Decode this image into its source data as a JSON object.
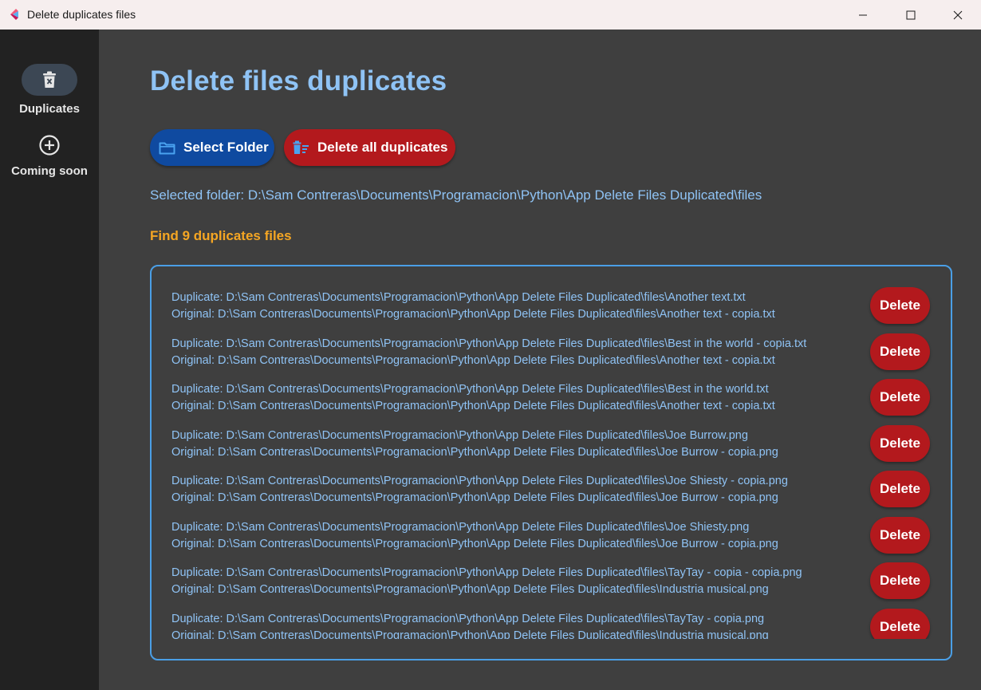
{
  "window": {
    "title": "Delete duplicates files"
  },
  "sidebar": {
    "items": [
      {
        "label": "Duplicates",
        "icon": "trash-icon",
        "selected": true
      },
      {
        "label": "Coming soon",
        "icon": "add-circle-icon",
        "selected": false
      }
    ]
  },
  "main": {
    "title": "Delete files duplicates",
    "select_folder_label": "Select Folder",
    "delete_all_label": "Delete all duplicates",
    "selected_folder": "Selected folder: D:\\Sam Contreras\\Documents\\Programacion\\Python\\App Delete Files Duplicated\\files",
    "duplicates_count": "Find 9 duplicates files",
    "delete_label": "Delete",
    "rows": [
      {
        "duplicate": "Duplicate: D:\\Sam Contreras\\Documents\\Programacion\\Python\\App Delete Files Duplicated\\files\\Another text.txt",
        "original": "Original: D:\\Sam Contreras\\Documents\\Programacion\\Python\\App Delete Files Duplicated\\files\\Another text - copia.txt"
      },
      {
        "duplicate": "Duplicate: D:\\Sam Contreras\\Documents\\Programacion\\Python\\App Delete Files Duplicated\\files\\Best in the world - copia.txt",
        "original": "Original: D:\\Sam Contreras\\Documents\\Programacion\\Python\\App Delete Files Duplicated\\files\\Another text - copia.txt"
      },
      {
        "duplicate": "Duplicate: D:\\Sam Contreras\\Documents\\Programacion\\Python\\App Delete Files Duplicated\\files\\Best in the world.txt",
        "original": "Original: D:\\Sam Contreras\\Documents\\Programacion\\Python\\App Delete Files Duplicated\\files\\Another text - copia.txt"
      },
      {
        "duplicate": "Duplicate: D:\\Sam Contreras\\Documents\\Programacion\\Python\\App Delete Files Duplicated\\files\\Joe Burrow.png",
        "original": "Original: D:\\Sam Contreras\\Documents\\Programacion\\Python\\App Delete Files Duplicated\\files\\Joe Burrow - copia.png"
      },
      {
        "duplicate": "Duplicate: D:\\Sam Contreras\\Documents\\Programacion\\Python\\App Delete Files Duplicated\\files\\Joe Shiesty - copia.png",
        "original": "Original: D:\\Sam Contreras\\Documents\\Programacion\\Python\\App Delete Files Duplicated\\files\\Joe Burrow - copia.png"
      },
      {
        "duplicate": "Duplicate: D:\\Sam Contreras\\Documents\\Programacion\\Python\\App Delete Files Duplicated\\files\\Joe Shiesty.png",
        "original": "Original: D:\\Sam Contreras\\Documents\\Programacion\\Python\\App Delete Files Duplicated\\files\\Joe Burrow - copia.png"
      },
      {
        "duplicate": "Duplicate: D:\\Sam Contreras\\Documents\\Programacion\\Python\\App Delete Files Duplicated\\files\\TayTay - copia - copia.png",
        "original": "Original: D:\\Sam Contreras\\Documents\\Programacion\\Python\\App Delete Files Duplicated\\files\\Industria musical.png"
      },
      {
        "duplicate": "Duplicate: D:\\Sam Contreras\\Documents\\Programacion\\Python\\App Delete Files Duplicated\\files\\TayTay - copia.png",
        "original": "Original: D:\\Sam Contreras\\Documents\\Programacion\\Python\\App Delete Files Duplicated\\files\\Industria musical.png"
      }
    ]
  },
  "colors": {
    "accent_blue": "#8fc3f5",
    "button_blue": "#0f4aa0",
    "button_red": "#b3191d",
    "warning_orange": "#f5a623",
    "list_border": "#4a9fe6"
  }
}
